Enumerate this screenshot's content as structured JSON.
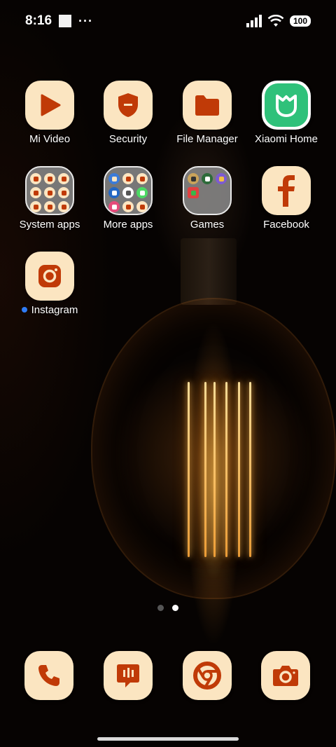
{
  "status_bar": {
    "time": "8:16",
    "overflow": "···",
    "battery": "100"
  },
  "apps": [
    {
      "label": "Mi Video",
      "icon": "play-icon"
    },
    {
      "label": "Security",
      "icon": "shield-icon"
    },
    {
      "label": "File Manager",
      "icon": "folder-icon"
    },
    {
      "label": "Xiaomi Home",
      "icon": "xiaomi-home-icon"
    },
    {
      "label": "System apps",
      "icon": "folder-grid-icon"
    },
    {
      "label": "More apps",
      "icon": "folder-grid-icon"
    },
    {
      "label": "Games",
      "icon": "folder-grid-icon"
    },
    {
      "label": "Facebook",
      "icon": "facebook-icon"
    },
    {
      "label": "Instagram",
      "icon": "instagram-icon"
    }
  ],
  "dock": [
    {
      "icon": "phone-icon"
    },
    {
      "icon": "messages-icon"
    },
    {
      "icon": "chrome-icon"
    },
    {
      "icon": "camera-icon"
    }
  ],
  "page_indicator": {
    "pages": 2,
    "active": 2
  },
  "colors": {
    "icon_bg": "#fbe5c1",
    "icon_fg": "#c03a07",
    "xiaomi_home_bg": "#2fc17a",
    "notification_dot": "#2f7cf5"
  }
}
